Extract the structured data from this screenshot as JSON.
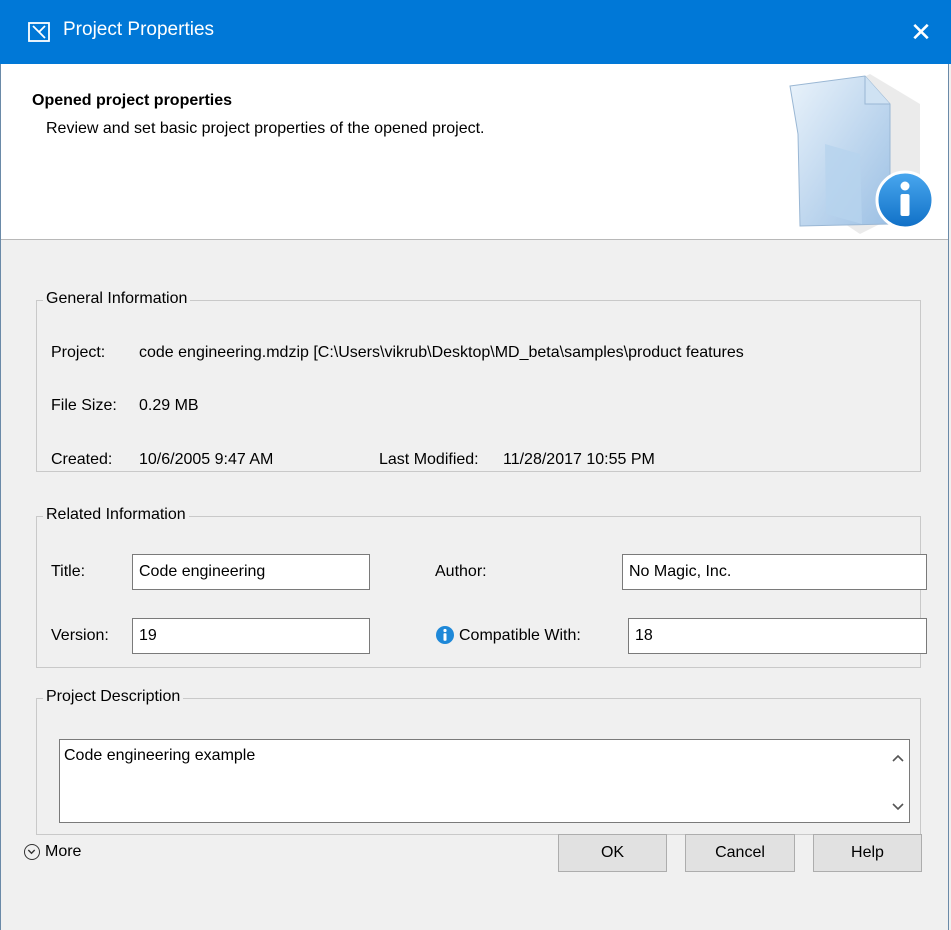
{
  "window": {
    "title": "Project Properties",
    "close_glyph": "✕"
  },
  "header": {
    "title": "Opened project properties",
    "description": "Review and set basic project properties of the opened project."
  },
  "general": {
    "legend": "General Information",
    "project_label": "Project:",
    "project_value": "code engineering.mdzip [C:\\Users\\vikrub\\Desktop\\MD_beta\\samples\\product features",
    "filesize_label": "File Size:",
    "filesize_value": "0.29 MB",
    "created_label": "Created:",
    "created_value": "10/6/2005 9:47 AM",
    "modified_label": "Last Modified:",
    "modified_value": "11/28/2017 10:55 PM"
  },
  "related": {
    "legend": "Related Information",
    "title_label": "Title:",
    "title_value": "Code engineering",
    "author_label": "Author:",
    "author_value": "No Magic, Inc.",
    "version_label": "Version:",
    "version_value": "19",
    "compatible_label": "Compatible With:",
    "compatible_value": "18"
  },
  "description": {
    "legend": "Project Description",
    "value": "Code engineering example"
  },
  "footer": {
    "more_label": "More",
    "ok_label": "OK",
    "cancel_label": "Cancel",
    "help_label": "Help"
  },
  "icons": {
    "app": "project-icon",
    "close": "close-icon",
    "info": "info-icon",
    "more": "chevron-down-circle-icon",
    "scroll_up": "chevron-up-icon",
    "scroll_down": "chevron-down-icon"
  },
  "colors": {
    "titlebar": "#0078d7",
    "info_blue": "#1e88d8"
  }
}
